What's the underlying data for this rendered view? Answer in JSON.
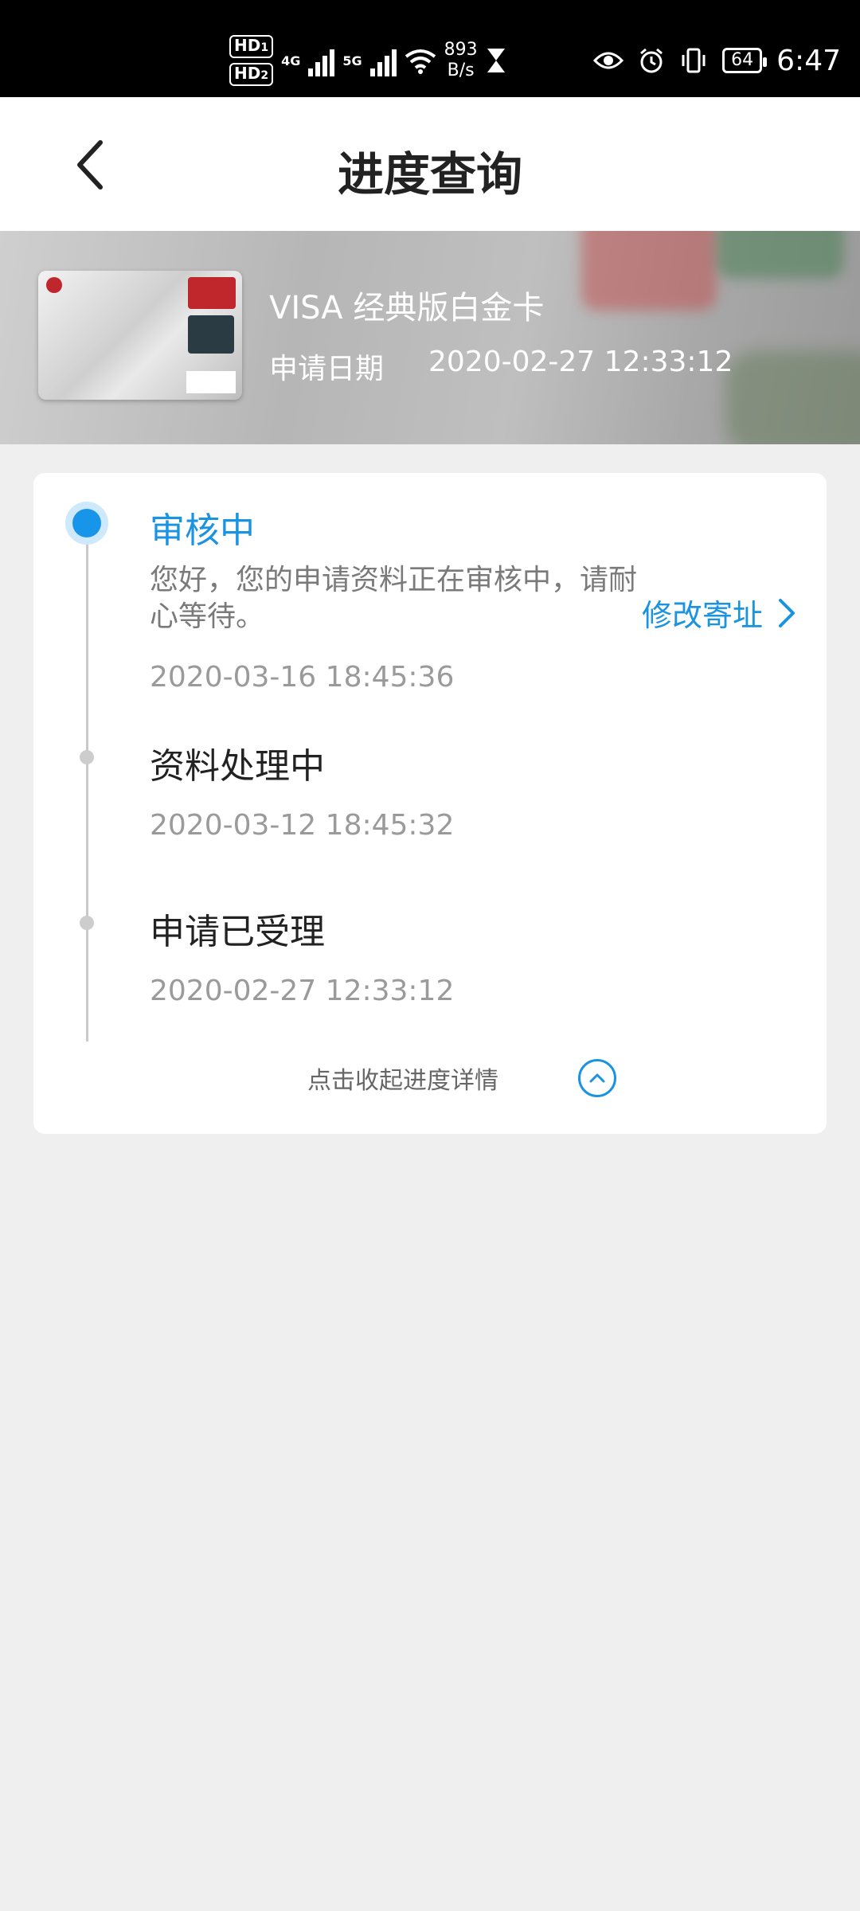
{
  "status_bar": {
    "hd1": "HD",
    "hd1_sub": "1",
    "hd2": "HD",
    "hd2_sub": "2",
    "sig1": "4G",
    "sig2": "5G",
    "speed_value": "893",
    "speed_unit": "B/s",
    "battery": "64",
    "time": "6:47"
  },
  "header": {
    "title": "进度查询"
  },
  "card": {
    "name": "VISA 经典版白金卡",
    "apply_label": "申请日期",
    "apply_date": "2020-02-27 12:33:12"
  },
  "progress": {
    "steps": [
      {
        "title": "审核中",
        "desc": "您好，您的申请资料正在审核中，请耐心等待。",
        "time": "2020-03-16 18:45:36"
      },
      {
        "title": "资料处理中",
        "time": "2020-03-12 18:45:32"
      },
      {
        "title": "申请已受理",
        "time": "2020-02-27 12:33:12"
      }
    ],
    "modify_address": "修改寄址",
    "collapse_text": "点击收起进度详情"
  },
  "colors": {
    "accent": "#1a93e0",
    "background": "#efefef"
  }
}
